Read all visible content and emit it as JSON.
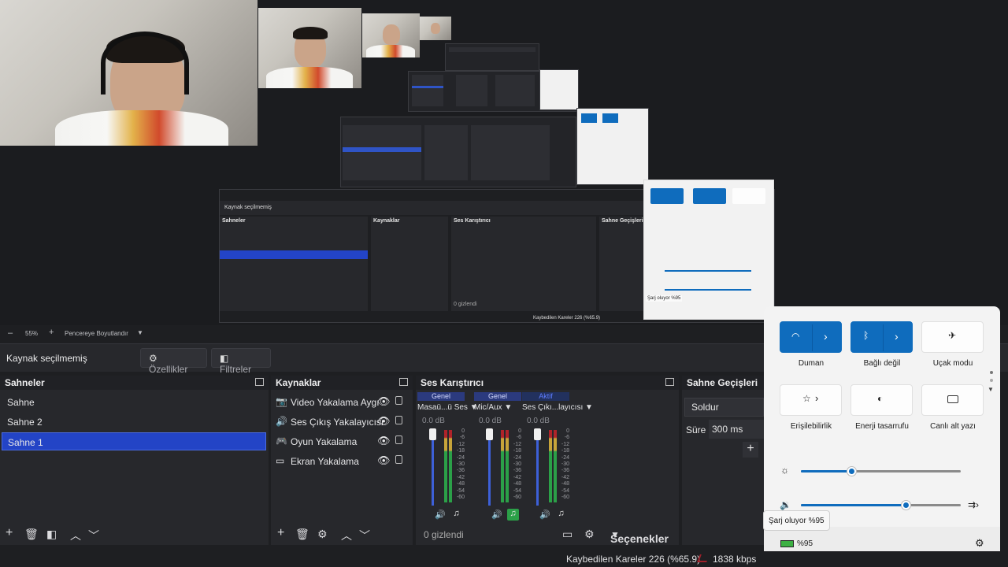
{
  "preview": {
    "zoom": "55%",
    "resize_label": "Pencereye Boyutlandır"
  },
  "inner_preview": {
    "source_label": "Kaynak seçilmemiş",
    "properties": "Özellikler",
    "filters": "Filtreler",
    "scenes_title": "Sahneler",
    "sources_title": "Kaynaklar",
    "mixer_title": "Ses Karıştırıcı",
    "transitions_title": "Sahne Geçişleri",
    "transition_value": "Soldur",
    "duration_label": "Süre",
    "duration_value": "300 ms",
    "hidden_count": "0 gizlendi",
    "options": "Seçenekler",
    "dropped": "Kaybedilen Kareler 226 (%65.9)",
    "kbps": "1838 kbps",
    "charging": "Şarj oluyor %95",
    "battery": "%95"
  },
  "source_toolbar": {
    "title": "Kaynak seçilmemiş",
    "properties": "Özellikler",
    "filters": "Filtreler"
  },
  "scenes": {
    "title": "Sahneler",
    "items": [
      "Sahne",
      "Sahne 2",
      "Sahne 1"
    ],
    "active_index": 2
  },
  "sources": {
    "title": "Kaynaklar",
    "items": [
      {
        "icon": "camera-icon",
        "label": "Video Yakalama Aygı"
      },
      {
        "icon": "speaker-icon",
        "label": "Ses Çıkış Yakalayıcısı"
      },
      {
        "icon": "gamepad-icon",
        "label": "Oyun Yakalama"
      },
      {
        "icon": "monitor-icon",
        "label": "Ekran Yakalama"
      }
    ]
  },
  "mixer": {
    "title": "Ses Karıştırıcı",
    "channels": [
      {
        "tag": "Genel",
        "name": "Masaü...ü Ses",
        "db": "0.0 dB"
      },
      {
        "tag": "Genel",
        "name": "Mic/Aux",
        "db": "0.0 dB"
      },
      {
        "tag": "Aktif",
        "name": "Ses Çıkı...layıcısı",
        "db": "0.0 dB"
      }
    ],
    "meter_labels": [
      "0",
      "-6",
      "-12",
      "-18",
      "-24",
      "-30",
      "-36",
      "-42",
      "-48",
      "-54",
      "-60"
    ],
    "hidden_count": "0 gizlendi",
    "options": "Seçenekler"
  },
  "transitions": {
    "title": "Sahne Geçişleri",
    "transition": "Soldur",
    "duration_label": "Süre",
    "duration_value": "300 ms"
  },
  "quick_settings": {
    "tiles": [
      {
        "label": "Duman",
        "on": true,
        "icon": "wifi-icon"
      },
      {
        "label": "Bağlı değil",
        "on": true,
        "icon": "bluetooth-icon"
      },
      {
        "label": "Uçak modu",
        "on": false,
        "icon": "airplane-icon"
      },
      {
        "label": "Erişilebilirlik",
        "on": false,
        "icon": "accessibility-icon"
      },
      {
        "label": "Enerji tasarrufu",
        "on": false,
        "icon": "battery-saver-icon"
      },
      {
        "label": "Canlı alt yazı",
        "on": false,
        "icon": "captions-icon"
      }
    ],
    "brightness_fraction": 0.32,
    "volume_fraction": 0.66,
    "battery_text": "%95",
    "tooltip": "Şarj oluyor %95"
  },
  "status": {
    "dropped_frames": "Kaybedilen Kareler 226 (%65.9)",
    "kbps": "1838 kbps"
  },
  "colors": {
    "accent": "#2344c6",
    "win_accent": "#0f6cbd"
  }
}
